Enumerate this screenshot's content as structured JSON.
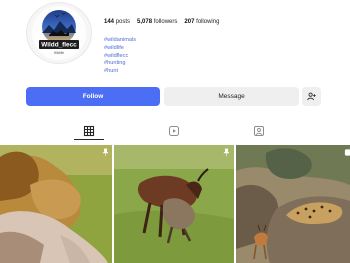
{
  "profile": {
    "username": "Wildd_flecc",
    "logo_subtext": "Wildlife",
    "stats": {
      "posts_value": "144",
      "posts_label": "posts",
      "followers_value": "5,078",
      "followers_label": "followers",
      "following_value": "207",
      "following_label": "following"
    },
    "bio": {
      "hashtags": [
        "#wildanimals",
        "#wildlife",
        "#wildflecc",
        "#hunting",
        "#hunt"
      ]
    }
  },
  "actions": {
    "follow_label": "Follow",
    "message_label": "Message"
  },
  "tabs": [
    {
      "icon": "grid-icon",
      "active": true
    },
    {
      "icon": "reels-icon",
      "active": false
    },
    {
      "icon": "tagged-icon",
      "active": false
    }
  ],
  "posts": [
    {
      "subject": "lions",
      "pinned": true
    },
    {
      "subject": "hyena-and-topi",
      "pinned": true
    },
    {
      "subject": "leopard-and-impala",
      "pinned": false
    }
  ],
  "colors": {
    "accent": "#4c6ef5",
    "link": "#4f6fd3",
    "secondary_button": "#efefef"
  }
}
